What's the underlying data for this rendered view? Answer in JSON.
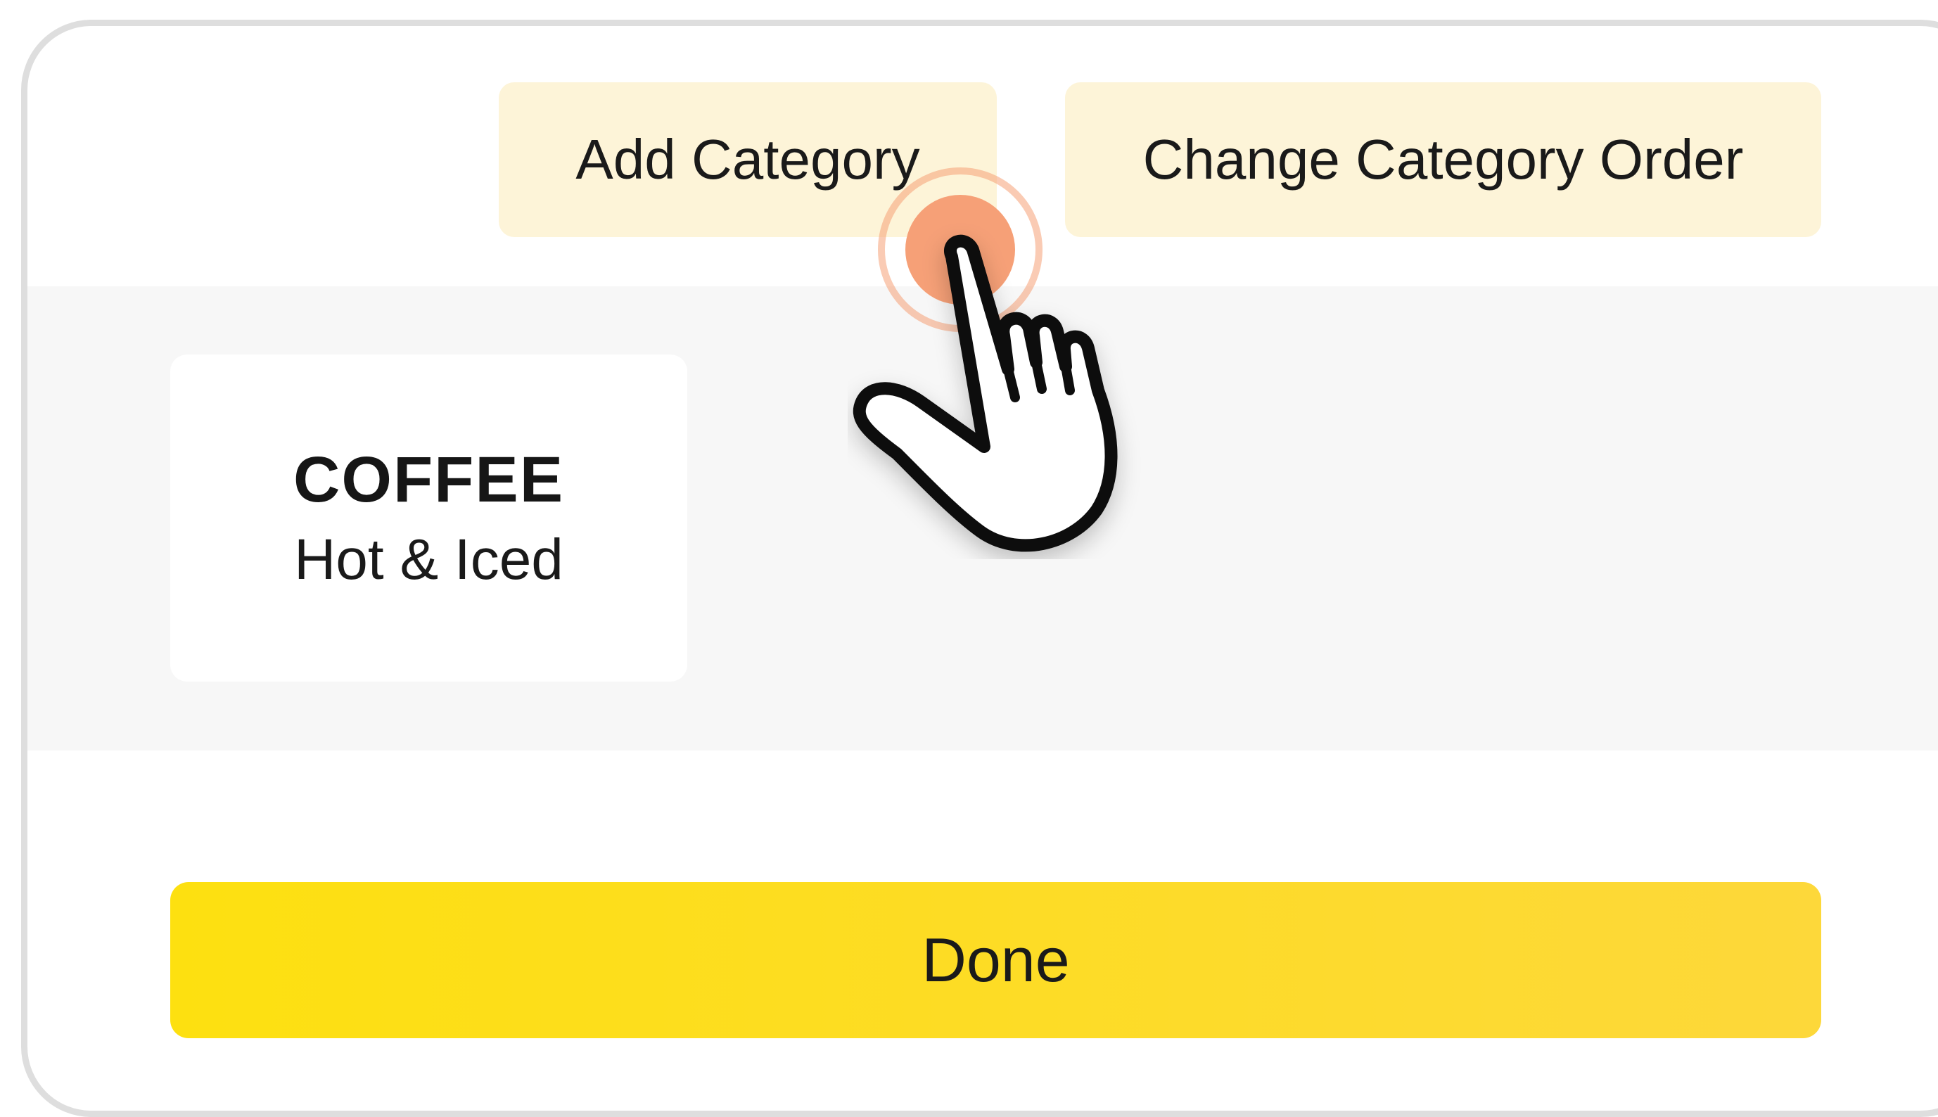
{
  "toolbar": {
    "add_category_label": "Add Category",
    "change_order_label": "Change Category Order"
  },
  "categories": [
    {
      "name": "COFFEE",
      "subtitle": "Hot & Iced"
    }
  ],
  "footer": {
    "done_label": "Done"
  },
  "overlay": {
    "pointer_icon": "tap-hand-icon"
  },
  "colors": {
    "button_bg": "#fdf4d8",
    "done_gradient_start": "#fde010",
    "done_gradient_end": "#fdd83a",
    "tap_indicator": "#f6a077"
  }
}
